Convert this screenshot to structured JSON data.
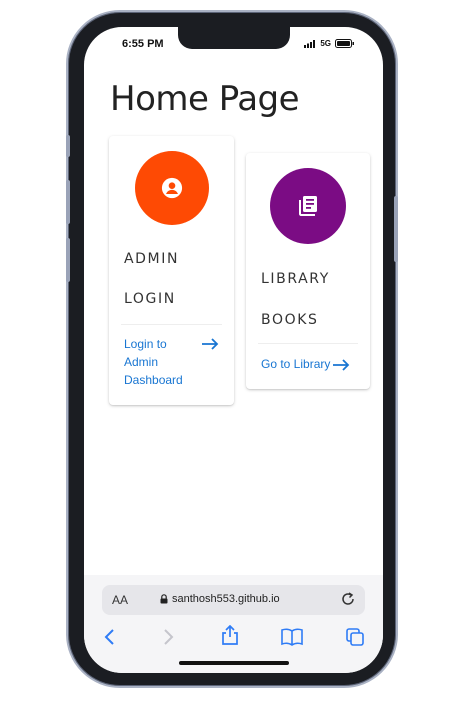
{
  "status_bar": {
    "time": "6:55 PM",
    "network": "5G"
  },
  "page": {
    "title": "Home Page"
  },
  "cards": [
    {
      "line1": "ADMIN",
      "line2": "LOGIN",
      "link": "Login to Admin Dashboard",
      "icon": "person-icon",
      "color": "#fe4a04"
    },
    {
      "line1": "LIBRARY",
      "line2": "BOOKS",
      "link": "Go to Library",
      "icon": "library-books-icon",
      "color": "#7b0c84"
    }
  ],
  "safari": {
    "text_size_label": "AA",
    "url": "santhosh553.github.io"
  },
  "theme": {
    "link_color": "#1976d2"
  }
}
